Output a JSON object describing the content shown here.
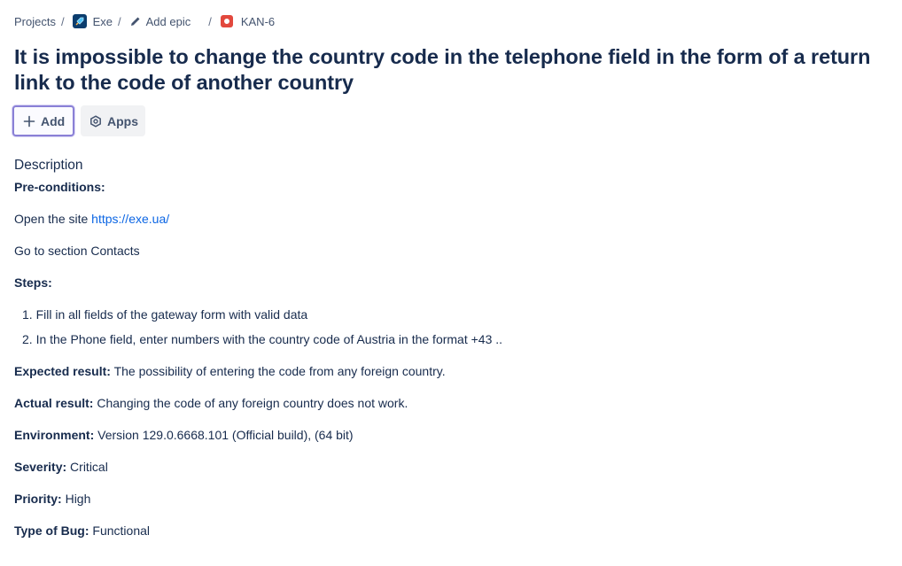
{
  "breadcrumb": {
    "projects": "Projects",
    "project": "Exe",
    "add_epic": "Add epic",
    "issue_key": "KAN-6"
  },
  "title": "It is impossible to change the country code in the telephone field in the form of a return link to the code of another country",
  "actions": {
    "add": "Add",
    "apps": "Apps"
  },
  "description": {
    "heading": "Description",
    "preconditions_label": "Pre-conditions:",
    "open_site_text": "Open the site ",
    "open_site_link": "https://exe.ua/",
    "go_to": "Go to section Contacts",
    "steps_label": "Steps:",
    "steps": [
      "1. Fill in all fields of the gateway form with valid data",
      "2. In the Phone field, enter numbers with the country code of Austria in the format +43 .."
    ],
    "expected_label": "Expected result:",
    "expected_value": " The possibility of entering the code from any foreign country.",
    "actual_label": "Actual result:",
    "actual_value": " Changing the code of any foreign country does not work.",
    "environment_label": "Environment:",
    "environment_value": " Version 129.0.6668.101 (Official build), (64 bit)",
    "severity_label": "Severity:",
    "severity_value": " Critical",
    "priority_label": "Priority:",
    "priority_value": " High",
    "bug_type_label": "Type of Bug:",
    "bug_type_value": " Functional"
  }
}
